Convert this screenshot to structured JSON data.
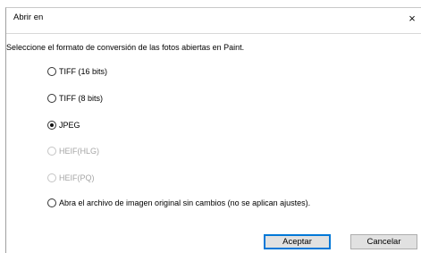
{
  "window": {
    "title": "Abrir en",
    "close_glyph": "×"
  },
  "prompt": "Seleccione el formato de conversión de las fotos abiertas en Paint.",
  "options": [
    {
      "label": "TIFF (16 bits)",
      "checked": false,
      "enabled": true
    },
    {
      "label": "TIFF (8 bits)",
      "checked": false,
      "enabled": true
    },
    {
      "label": "JPEG",
      "checked": true,
      "enabled": true
    },
    {
      "label": "HEIF(HLG)",
      "checked": false,
      "enabled": false
    },
    {
      "label": "HEIF(PQ)",
      "checked": false,
      "enabled": false
    },
    {
      "label": "Abra el archivo de imagen original sin cambios (no se aplican ajustes).",
      "checked": false,
      "enabled": true
    }
  ],
  "buttons": {
    "accept": "Aceptar",
    "cancel": "Cancelar"
  },
  "colors": {
    "accent": "#0078d7",
    "disabled_text": "#a6a6a6"
  }
}
